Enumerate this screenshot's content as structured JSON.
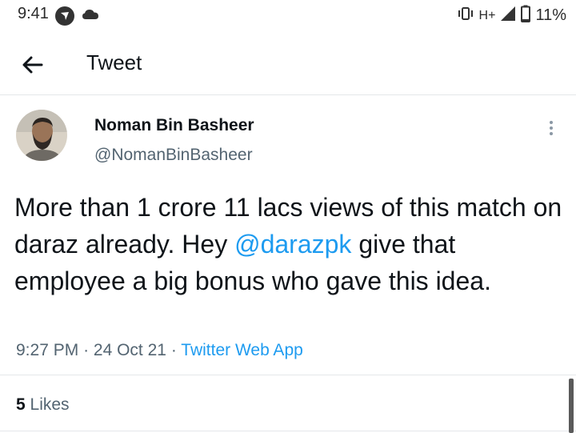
{
  "status_bar": {
    "time": "9:41",
    "network": "H+",
    "battery": "11%",
    "icons": [
      "navigation-icon",
      "cloud-icon",
      "vibrate-icon",
      "signal-icon",
      "battery-icon"
    ]
  },
  "header": {
    "title": "Tweet",
    "back_icon": "arrow-left-icon"
  },
  "tweet": {
    "author_name": "Noman Bin Basheer",
    "author_handle": "@NomanBinBasheer",
    "text_part1": "More than 1 crore 11 lacs views of this match on daraz already. Hey ",
    "mention": "@darazpk",
    "text_part2": " give that employee a big bonus who gave this idea.",
    "time": "9:27 PM",
    "date": "24 Oct 21",
    "source": "Twitter Web App",
    "separator": "·"
  },
  "stats": {
    "likes_count": "5",
    "likes_label": "Likes"
  },
  "colors": {
    "accent": "#1d9bf0",
    "text": "#0f1419",
    "secondary": "#536471",
    "divider": "#e4e7ea"
  }
}
